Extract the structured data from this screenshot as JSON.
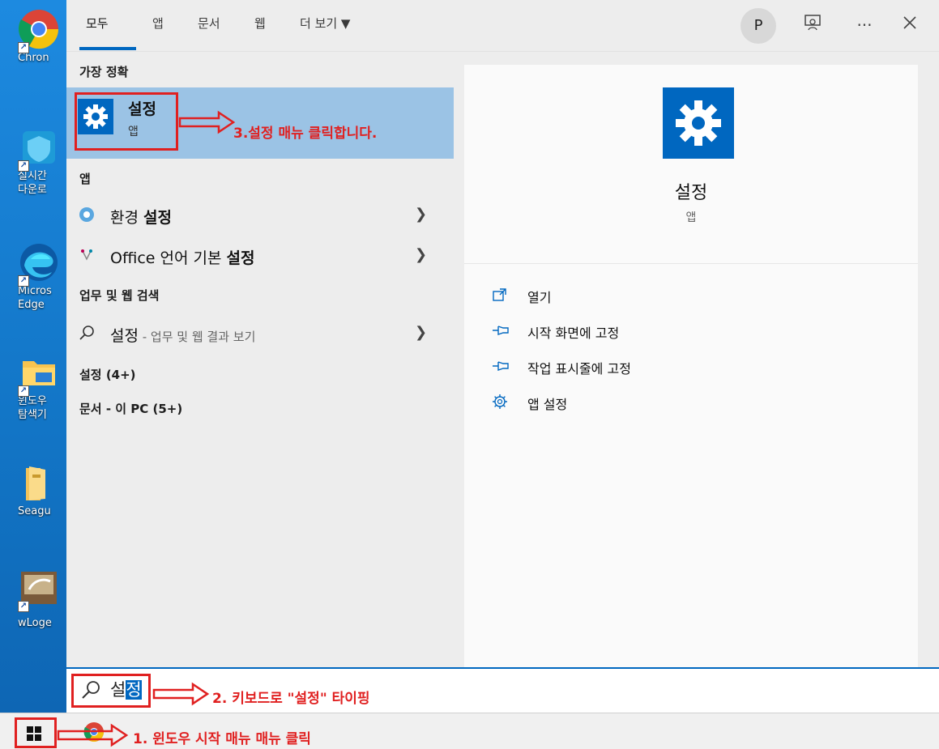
{
  "desktop": {
    "icons": [
      {
        "label": "Chron"
      },
      {
        "label": "실시간",
        "label2": "다운로"
      },
      {
        "label": "Micros",
        "label2": "Edge"
      },
      {
        "label": "윈도우",
        "label2": "탐색기"
      },
      {
        "label": "Seagu"
      },
      {
        "label": "wLoge"
      }
    ]
  },
  "tabs": {
    "all": "모두",
    "apps": "앱",
    "documents": "문서",
    "web": "웹",
    "more": "더 보기 ▼",
    "avatar_letter": "P"
  },
  "left": {
    "best_match_header": "가장 정확",
    "best_match": {
      "title": "설정",
      "subtitle": "앱"
    },
    "apps_header": "앱",
    "apps": [
      {
        "prefix": "환경 ",
        "bold": "설정"
      },
      {
        "prefix": "Office 언어 기본 ",
        "bold": "설정"
      }
    ],
    "web_header": "업무 및 웹 검색",
    "web_result": {
      "term": "설정",
      "suffix": " - 업무 및 웹 결과 보기"
    },
    "settings_header": "설정 (4+)",
    "docs_header": "문서 - 이 PC (5+)"
  },
  "right": {
    "title": "설정",
    "subtitle": "앱",
    "actions": [
      {
        "label": "열기",
        "icon": "open-icon"
      },
      {
        "label": "시작 화면에 고정",
        "icon": "pin-icon"
      },
      {
        "label": "작업 표시줄에 고정",
        "icon": "pin-icon"
      },
      {
        "label": "앱 설정",
        "icon": "gear-icon"
      }
    ]
  },
  "search": {
    "typed": "설",
    "selected": "정"
  },
  "annotations": {
    "step1": "1. 윈도우 시작 매뉴 매뉴 클릭",
    "step2": "2. 키보드로 \"설정\" 타이핑",
    "step3": "3.설정 매뉴 클릭합니다."
  },
  "colors": {
    "accent": "#0067c0",
    "annotation": "#e02020",
    "selection": "#9bc3e5"
  }
}
